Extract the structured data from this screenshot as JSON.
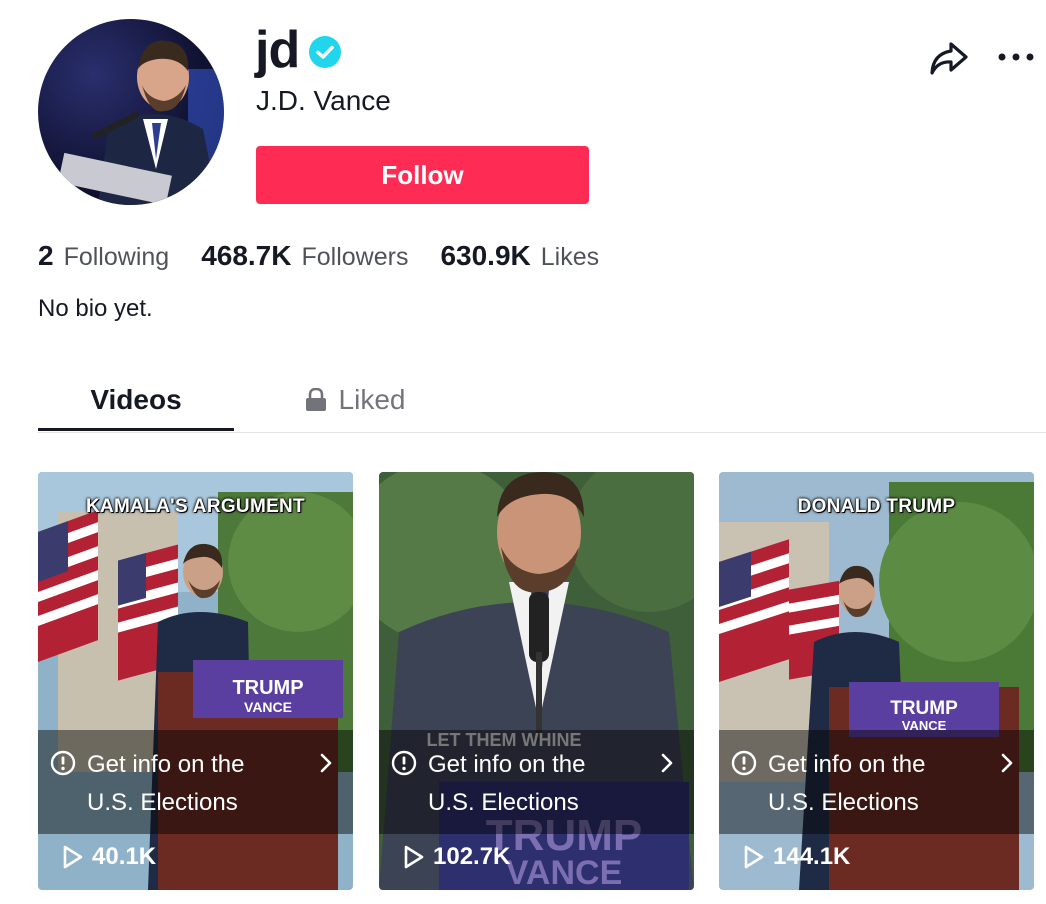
{
  "profile": {
    "username": "jd",
    "display_name": "J.D. Vance",
    "verified": true,
    "follow_label": "Follow",
    "bio": "No bio yet."
  },
  "stats": [
    {
      "value": "2",
      "label": "Following"
    },
    {
      "value": "468.7K",
      "label": "Followers"
    },
    {
      "value": "630.9K",
      "label": "Likes"
    }
  ],
  "tabs": {
    "videos": "Videos",
    "liked": "Liked"
  },
  "videos": [
    {
      "overlay": "KAMALA'S ARGUMENT",
      "info_line1": "Get info on the",
      "info_line2": "U.S. Elections",
      "views": "40.1K"
    },
    {
      "overlay": "",
      "info_line1": "Get info on the",
      "info_line2": "U.S. Elections",
      "views": "102.7K"
    },
    {
      "overlay": "DONALD TRUMP",
      "info_line1": "Get info on the",
      "info_line2": "U.S. Elections",
      "views": "144.1K"
    }
  ],
  "colors": {
    "brand": "#fe2c55",
    "verified": "#20d5ec",
    "text": "#161823"
  },
  "icons": [
    "verified-badge-icon",
    "share-icon",
    "more-icon",
    "lock-icon",
    "info-icon",
    "chevron-right-icon",
    "play-icon"
  ]
}
